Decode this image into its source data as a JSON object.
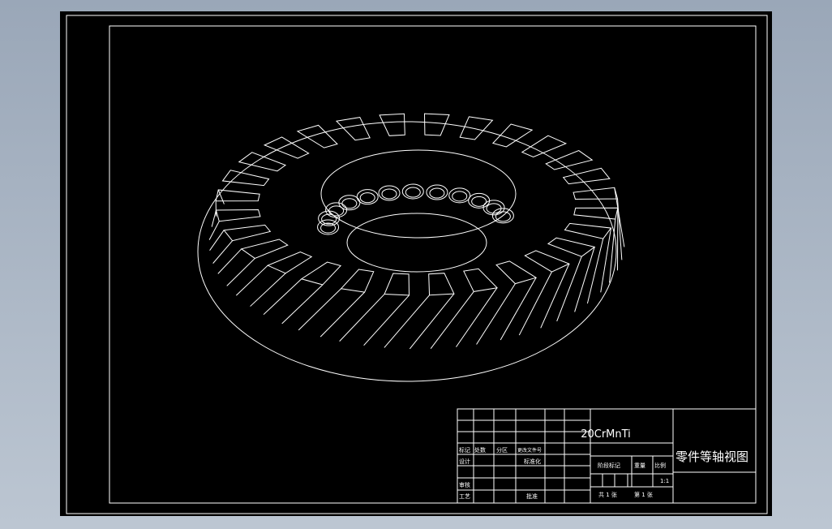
{
  "drawing": {
    "view": "isometric",
    "part": "spiral-bevel-gear",
    "tooth_count": 28,
    "bolt_hole_count": 12,
    "line_color": "#ffffff",
    "background_color": "#000000",
    "backdrop_color": "#a9b4c4"
  },
  "title_block": {
    "material": "20CrMnTi",
    "title": "零件等轴视图",
    "scale": "1:1",
    "sheets_total_label": "共 1 张",
    "sheet_number_label": "第 1 张",
    "labels": {
      "mark": "标记",
      "count": "处数",
      "zone": "分区",
      "change_doc": "更改文件号",
      "design": "设计",
      "standardize": "标准化",
      "review": "审核",
      "process": "工艺",
      "approve": "批准",
      "stage_mark": "阶段标记",
      "weight": "重量",
      "scale_label": "比例"
    }
  }
}
